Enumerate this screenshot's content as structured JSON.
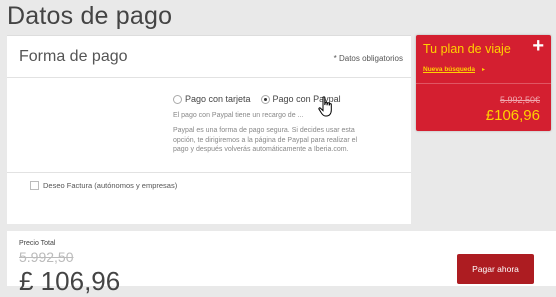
{
  "page": {
    "title": "Datos de pago"
  },
  "payment_form": {
    "title": "Forma de pago",
    "required_note": "* Datos obligatorios",
    "options": [
      {
        "label": "Pago con tarjeta",
        "selected": false
      },
      {
        "label": "Pago con Paypal",
        "selected": true
      }
    ],
    "surcharge_note": "El pago con Paypal tiene un recargo de ...",
    "info_lines": [
      "Paypal es una forma de pago segura. Si decides usar esta",
      "opción, te dirigiremos a la página de Paypal para realizar el",
      "pago y después volverás automáticamente a Iberia.com."
    ],
    "invoice_label": "Deseo Factura (autónomos y empresas)"
  },
  "plan": {
    "title": "Tu plan de viaje",
    "plus_icon": "plus-icon",
    "link_label": "Nueva búsqueda",
    "link_arrow": "▸",
    "old_price": "5.992,50€",
    "price": "£106,96"
  },
  "footer": {
    "label": "Precio Total",
    "old_price": "5.992,50",
    "price": "£ 106,96",
    "pay_button": "Pagar ahora"
  },
  "colors": {
    "accent": "#d41f30",
    "button": "#ad1c21",
    "highlight": "#ffd100"
  }
}
